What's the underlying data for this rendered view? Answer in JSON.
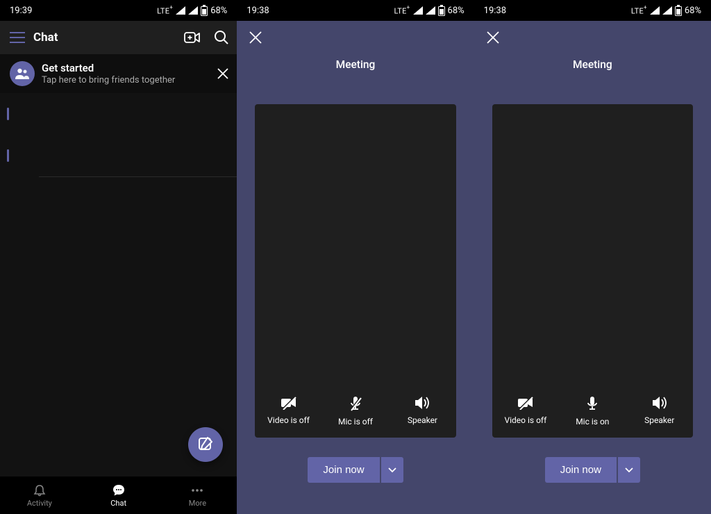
{
  "panel1": {
    "status": {
      "time": "19:39",
      "network": "LTE",
      "battery": "68%"
    },
    "header": {
      "title": "Chat"
    },
    "getStarted": {
      "title": "Get started",
      "subtitle": "Tap here to bring friends together"
    },
    "nav": {
      "activity": "Activity",
      "chat": "Chat",
      "more": "More"
    }
  },
  "panel2": {
    "status": {
      "time": "19:38",
      "network": "LTE",
      "battery": "68%"
    },
    "title": "Meeting",
    "toggles": {
      "video": "Video is off",
      "mic": "Mic is off",
      "speaker": "Speaker"
    },
    "join": "Join now"
  },
  "panel3": {
    "status": {
      "time": "19:38",
      "network": "LTE",
      "battery": "68%"
    },
    "title": "Meeting",
    "toggles": {
      "video": "Video is off",
      "mic": "Mic is on",
      "speaker": "Speaker"
    },
    "join": "Join now"
  }
}
